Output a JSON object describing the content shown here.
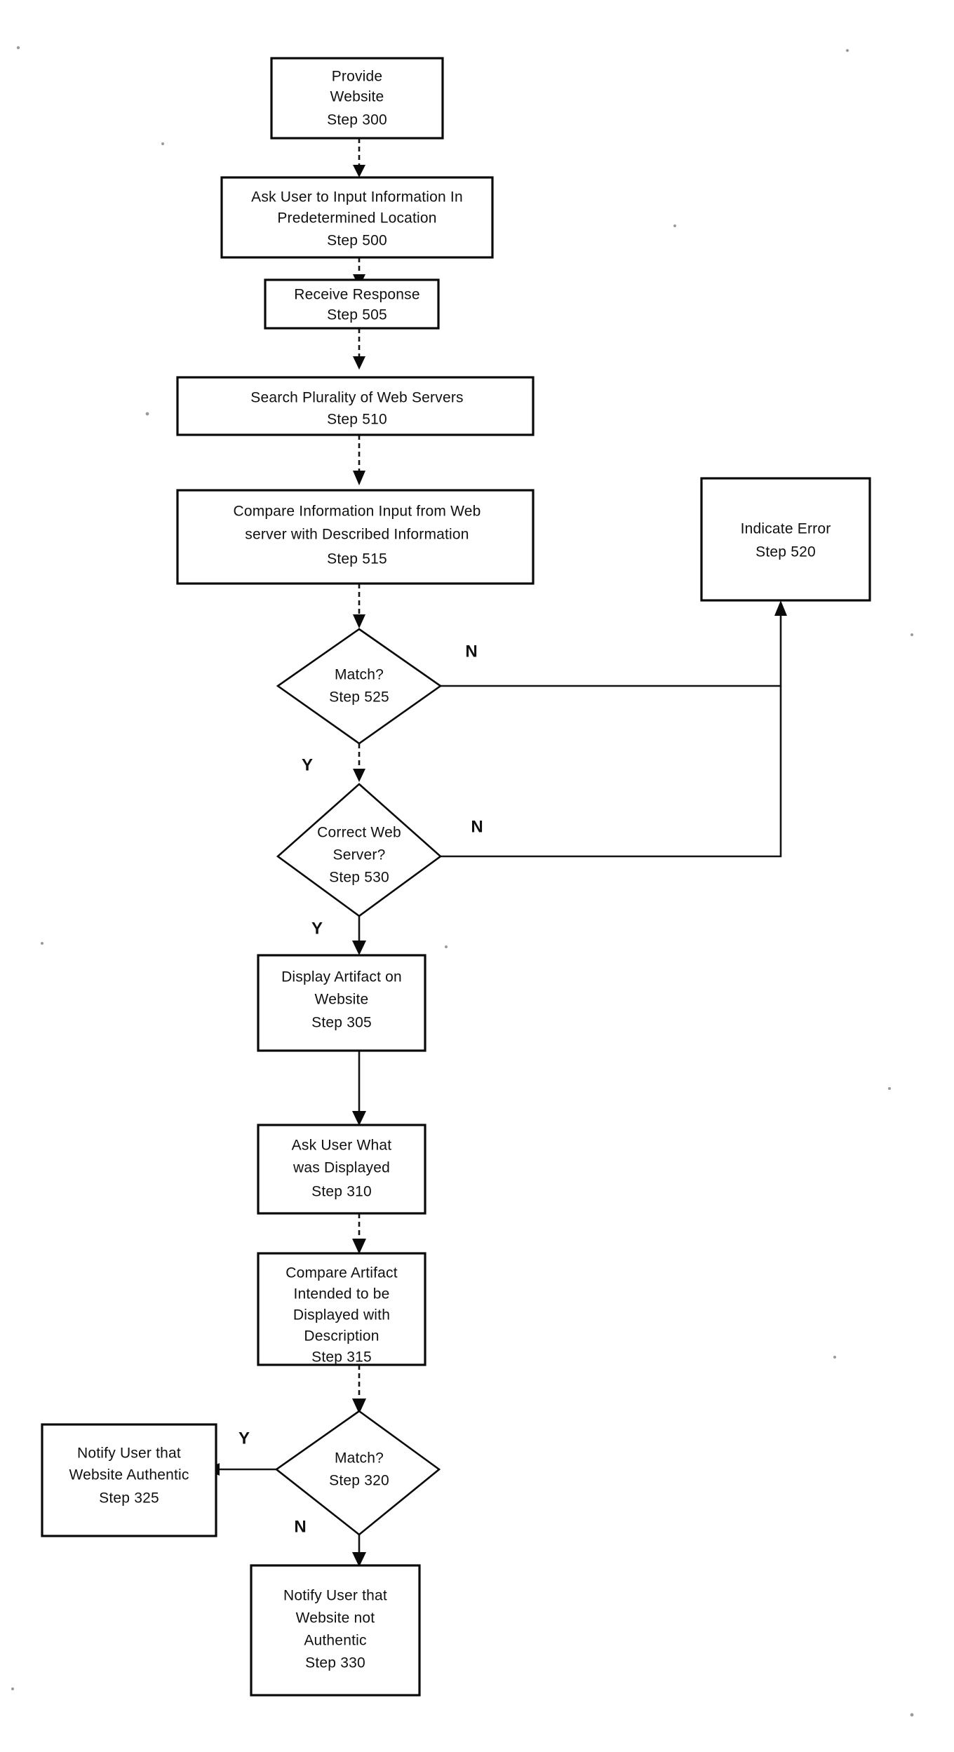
{
  "document": {
    "type": "patent-flowchart",
    "background_color": "#ffffff",
    "ink_color": "#101010"
  },
  "nodes": [
    {
      "id": "step300",
      "shape": "rect",
      "lines": [
        "Provide",
        "Website",
        "Step 300"
      ]
    },
    {
      "id": "step500",
      "shape": "rect",
      "lines": [
        "Ask User to Input Information In",
        "Predetermined Location",
        "Step 500"
      ]
    },
    {
      "id": "step505",
      "shape": "rect",
      "lines": [
        "Receive Response",
        "Step 505"
      ]
    },
    {
      "id": "step510",
      "shape": "rect",
      "lines": [
        "Search Plurality of Web Servers",
        "Step 510"
      ]
    },
    {
      "id": "step515",
      "shape": "rect",
      "lines": [
        "Compare Information Input from Web",
        "server with Described Information",
        "Step 515"
      ]
    },
    {
      "id": "step520",
      "shape": "rect",
      "lines": [
        "Indicate Error",
        "Step 520"
      ]
    },
    {
      "id": "step525",
      "shape": "diamond",
      "lines": [
        "Match?",
        "Step 525"
      ]
    },
    {
      "id": "step530",
      "shape": "diamond",
      "lines": [
        "Correct Web",
        "Server?",
        "Step 530"
      ]
    },
    {
      "id": "step305",
      "shape": "rect",
      "lines": [
        "Display Artifact on",
        "Website",
        "Step 305"
      ]
    },
    {
      "id": "step310",
      "shape": "rect",
      "lines": [
        "Ask User What",
        "was Displayed",
        "Step 310"
      ]
    },
    {
      "id": "step315",
      "shape": "rect",
      "lines": [
        "Compare Artifact",
        "Intended to be",
        "Displayed with",
        "Description",
        "Step 315"
      ]
    },
    {
      "id": "step320",
      "shape": "diamond",
      "lines": [
        "Match?",
        "Step 320"
      ]
    },
    {
      "id": "step325",
      "shape": "rect",
      "lines": [
        "Notify User that",
        "Website Authentic",
        "Step 325"
      ]
    },
    {
      "id": "step330",
      "shape": "rect",
      "lines": [
        "Notify User that",
        "Website not",
        "Authentic",
        "Step 330"
      ]
    }
  ],
  "branch_labels": {
    "match525_no": "N",
    "match525_yes": "Y",
    "server530_no": "N",
    "server530_yes": "Y",
    "match320_yes": "Y",
    "match320_no": "N"
  }
}
